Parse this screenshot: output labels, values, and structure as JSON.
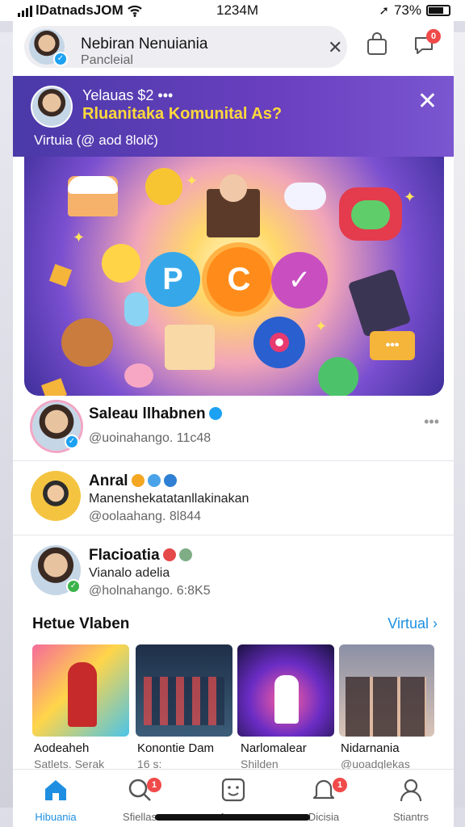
{
  "status_bar": {
    "carrier": "lDatnadsJOМ",
    "time": "1234M",
    "battery": "73%"
  },
  "topbar": {
    "name": "Nebiran Nenuiania",
    "subtitle": "Pancleial",
    "notifications_badge": "0"
  },
  "promo": {
    "time": "Yelauas $2 •••",
    "title": "Rluanitaka Komunital As?",
    "user": "Virtuia  (@ aod 8lolč)"
  },
  "posts": [
    {
      "name": "Saleau llhabnen",
      "handle": "@uoinahango. 11c48"
    },
    {
      "name": "Anral",
      "text": "Manenshekatatanllakinakan",
      "handle": "@oolaahang. 8l844"
    },
    {
      "name": "Flacioatia",
      "text": "Vianalo adelia",
      "handle": "@holnahango. 6:8K5"
    }
  ],
  "section": {
    "title": "Hetue Vlaben",
    "link": "Virtual ›"
  },
  "videos": [
    {
      "title": "Aodeaheh",
      "sub": "Satlets. Serak"
    },
    {
      "title": "Konontie Dam",
      "sub": "16 s:"
    },
    {
      "title": "Narlomalear",
      "sub": "Shilden"
    },
    {
      "title": "Nidarnania",
      "sub": "@uoadglekas"
    }
  ],
  "bottom_nav": [
    {
      "label": "Hibuania",
      "icon": "home-icon",
      "active": true
    },
    {
      "label": "Sfiellas",
      "icon": "search-icon",
      "badge": "1"
    },
    {
      "label": "Asass",
      "icon": "smile-icon"
    },
    {
      "label": "Dicisia",
      "icon": "bell-icon",
      "badge": "1"
    },
    {
      "label": "Stiantrs",
      "icon": "profile-icon"
    }
  ],
  "colors": {
    "accent": "#1e8fe0",
    "promo_title": "#ffd93b",
    "badge_red": "#f04a4a",
    "verified": "#1da1f2"
  }
}
